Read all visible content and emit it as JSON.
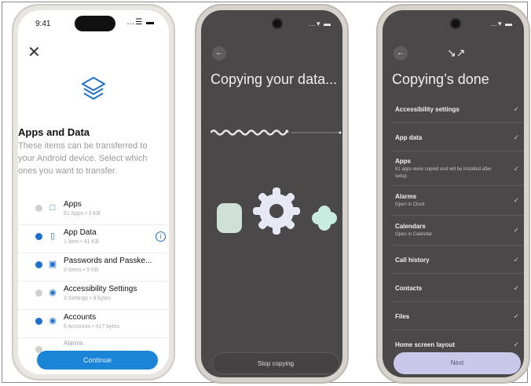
{
  "ios": {
    "time": "9:41",
    "status_icons": "…☰ ▬",
    "close_glyph": "✕",
    "title": "Apps and Data",
    "description": "These items can be transferred to your Android device. Select which ones you want to transfer.",
    "items": [
      {
        "name": "Apps",
        "sub": "61 Apps • 3 KB",
        "checked": false,
        "icon": "app-icon",
        "glyph": "□",
        "info": false
      },
      {
        "name": "App Data",
        "sub": "1 Item • 41 KB",
        "checked": true,
        "icon": "phone-icon",
        "glyph": "▯",
        "info": true
      },
      {
        "name": "Passwords and Passke...",
        "sub": "9 Items • 5 KB",
        "checked": true,
        "icon": "lock-icon",
        "glyph": "▣",
        "info": false
      },
      {
        "name": "Accessibility Settings",
        "sub": "3 Settings • 9 bytes",
        "checked": false,
        "icon": "accessibility-icon",
        "glyph": "◉",
        "info": false
      },
      {
        "name": "Accounts",
        "sub": "6 Accounts • 417 bytes",
        "checked": true,
        "icon": "account-icon",
        "glyph": "◉",
        "info": false
      },
      {
        "name": "Alarms",
        "sub": "",
        "checked": false,
        "icon": "alarm-icon",
        "glyph": "",
        "info": false
      }
    ],
    "info_glyph": "i",
    "continue_label": "Continue"
  },
  "copying": {
    "status_icons": "…▾ ▬",
    "back_glyph": "←",
    "title": "Copying your data...",
    "progress": 0.6,
    "stop_label": "Stop copying"
  },
  "done": {
    "status_icons": "…▾ ▬",
    "back_glyph": "←",
    "shrink_glyph": "↘↗",
    "title": "Copying’s done",
    "check_glyph": "✓",
    "items": [
      {
        "name": "Accessibility settings",
        "sub": ""
      },
      {
        "name": "App data",
        "sub": ""
      },
      {
        "name": "Apps",
        "sub": "61 apps were copied and will be installed after setup"
      },
      {
        "name": "Alarms",
        "sub": "Open in Clock"
      },
      {
        "name": "Calendars",
        "sub": "Open in Calendar"
      },
      {
        "name": "Call history",
        "sub": ""
      },
      {
        "name": "Contacts",
        "sub": ""
      },
      {
        "name": "Files",
        "sub": ""
      },
      {
        "name": "Home screen layout",
        "sub": ""
      }
    ],
    "next_label": "Next"
  }
}
